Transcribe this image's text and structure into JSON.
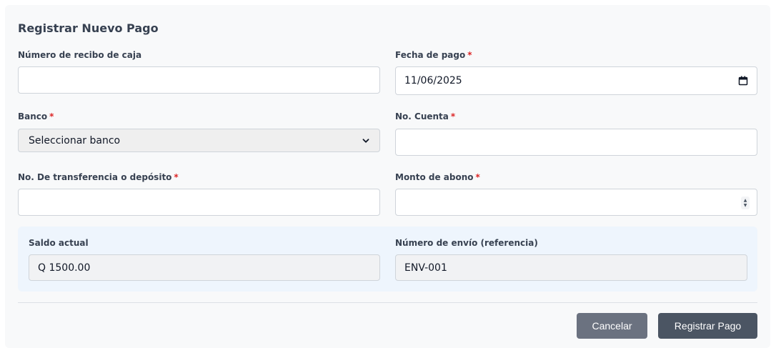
{
  "form": {
    "title": "Registrar Nuevo Pago",
    "fields": {
      "receipt": {
        "label": "Número de recibo de caja",
        "value": ""
      },
      "payment_date": {
        "label": "Fecha de pago",
        "required": "*",
        "value": "11/06/2025"
      },
      "bank": {
        "label": "Banco",
        "required": "*",
        "selected": "Seleccionar banco"
      },
      "account": {
        "label": "No. Cuenta",
        "required": "*",
        "value": ""
      },
      "transfer": {
        "label": "No. De transferencia o depósito",
        "required": "*",
        "value": ""
      },
      "amount": {
        "label": "Monto de abono",
        "required": "*",
        "value": ""
      }
    },
    "info": {
      "balance": {
        "label": "Saldo actual",
        "value": "Q 1500.00"
      },
      "shipment": {
        "label": "Número de envío (referencia)",
        "value": "ENV-001"
      }
    },
    "actions": {
      "cancel_label": "Cancelar",
      "submit_label": "Registrar Pago"
    }
  },
  "colors": {
    "required": "#dc2626",
    "cancel_button": "#6b7280",
    "submit_button": "#4b5563",
    "info_panel": "#eef5fd"
  },
  "icons": {
    "date_picker": "calendar-icon",
    "select_arrow": "chevron-down-icon",
    "number_spinner": "spinner-icon"
  }
}
